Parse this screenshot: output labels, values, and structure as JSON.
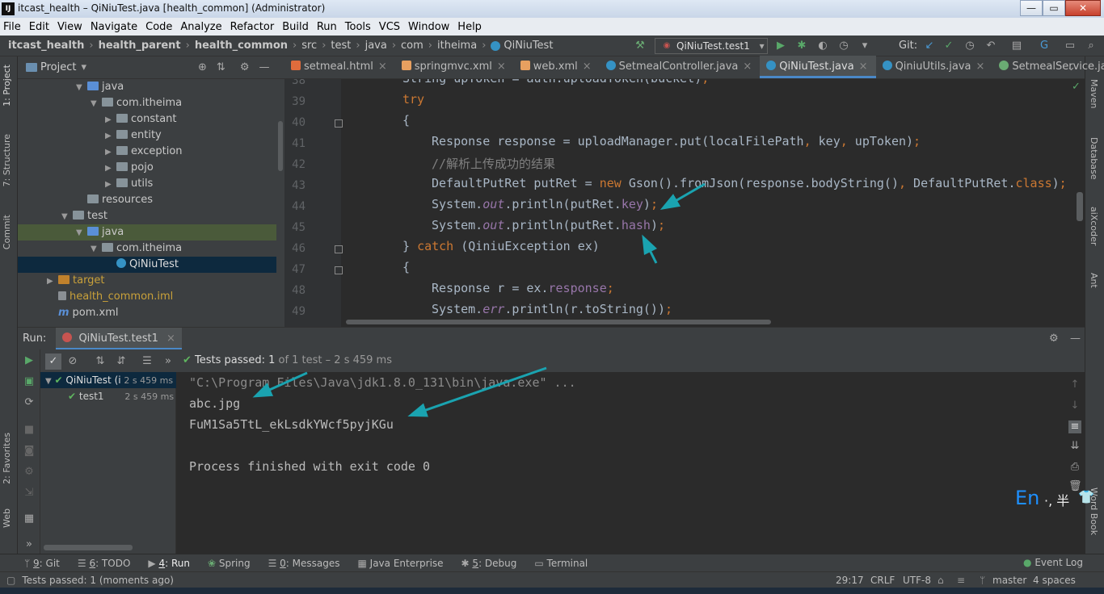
{
  "window": {
    "title": "itcast_health – QiNiuTest.java [health_common] (Administrator)",
    "logo": "IJ",
    "minimize": "—",
    "maximize": "▭",
    "close": "✕"
  },
  "menu": [
    "File",
    "Edit",
    "View",
    "Navigate",
    "Code",
    "Analyze",
    "Refactor",
    "Build",
    "Run",
    "Tools",
    "VCS",
    "Window",
    "Help"
  ],
  "breadcrumb": [
    "itcast_health",
    "health_parent",
    "health_common",
    "src",
    "test",
    "java",
    "com",
    "itheima",
    "QiNiuTest"
  ],
  "toolbar": {
    "run_config": "QiNiuTest.test1",
    "git_label": "Git:"
  },
  "left_strip": [
    "1: Project",
    "7: Structure",
    "Commit",
    "2: Favorites",
    "Web"
  ],
  "right_strip": [
    "Maven",
    "Database",
    "aiXcoder",
    "Ant",
    "Word Book"
  ],
  "project": {
    "header": "Project",
    "tree": [
      {
        "label": "java",
        "indent": 5,
        "arrow": "▼",
        "kind": "src"
      },
      {
        "label": "com.itheima",
        "indent": 6,
        "arrow": "▼",
        "kind": "pkg"
      },
      {
        "label": "constant",
        "indent": 7,
        "arrow": "▶",
        "kind": "pkg"
      },
      {
        "label": "entity",
        "indent": 7,
        "arrow": "▶",
        "kind": "pkg"
      },
      {
        "label": "exception",
        "indent": 7,
        "arrow": "▶",
        "kind": "pkg"
      },
      {
        "label": "pojo",
        "indent": 7,
        "arrow": "▶",
        "kind": "pkg"
      },
      {
        "label": "utils",
        "indent": 7,
        "arrow": "▶",
        "kind": "pkg"
      },
      {
        "label": "resources",
        "indent": 5,
        "arrow": "",
        "kind": "folder"
      },
      {
        "label": "test",
        "indent": 4,
        "arrow": "▼",
        "kind": "folder"
      },
      {
        "label": "java",
        "indent": 5,
        "arrow": "▼",
        "kind": "src"
      },
      {
        "label": "com.itheima",
        "indent": 6,
        "arrow": "▼",
        "kind": "pkg"
      },
      {
        "label": "QiNiuTest",
        "indent": 7,
        "arrow": "",
        "kind": "class"
      },
      {
        "label": "target",
        "indent": 3,
        "arrow": "▶",
        "kind": "target"
      },
      {
        "label": "health_common.iml",
        "indent": 3,
        "arrow": "",
        "kind": "iml"
      },
      {
        "label": "pom.xml",
        "indent": 3,
        "arrow": "",
        "kind": "pom"
      }
    ]
  },
  "tabs": [
    {
      "label": "setmeal.html",
      "icon": "html"
    },
    {
      "label": "springmvc.xml",
      "icon": "xml"
    },
    {
      "label": "web.xml",
      "icon": "xml"
    },
    {
      "label": "SetmealController.java",
      "icon": "class"
    },
    {
      "label": "QiNiuTest.java",
      "icon": "class",
      "active": true
    },
    {
      "label": "QiniuUtils.java",
      "icon": "class"
    },
    {
      "label": "SetmealService.java",
      "icon": "iface"
    }
  ],
  "editor": {
    "line_numbers": [
      "38",
      "39",
      "40",
      "41",
      "42",
      "43",
      "44",
      "45",
      "46",
      "47",
      "48",
      "49"
    ],
    "lines": [
      "String upToken = auth.uploadToken(bucket);",
      "try",
      "{",
      "Response response = uploadManager.put(localFilePath, key, upToken);",
      "//解析上传成功的结果",
      "DefaultPutRet putRet = new Gson().fromJson(response.bodyString(), DefaultPutRet.class);",
      "System.out.println(putRet.key);",
      "System.out.println(putRet.hash);",
      "} catch (QiniuException ex)",
      "{",
      "Response r = ex.response;",
      "System.err.println(r.toString());"
    ]
  },
  "run": {
    "label": "Run:",
    "tab": "QiNiuTest.test1",
    "status_bold": "Tests passed: 1",
    "status_rest": " of 1 test – 2 s 459 ms",
    "tree": [
      {
        "label": "QiNiuTest (i",
        "time": "2 s 459 ms"
      },
      {
        "label": "test1",
        "time": "2 s 459 ms"
      }
    ],
    "console": [
      "\"C:\\Program Files\\Java\\jdk1.8.0_131\\bin\\java.exe\" ...",
      "abc.jpg",
      "FuM1Sa5TtL_ekLsdkYWcf5pyjKGu",
      "",
      "Process finished with exit code 0"
    ]
  },
  "bottom_tabs": [
    {
      "num": "9",
      "label": ": Git"
    },
    {
      "num": "6",
      "label": ": TODO"
    },
    {
      "num": "4",
      "label": ": Run"
    },
    {
      "num": "",
      "label": "Spring"
    },
    {
      "num": "0",
      "label": ": Messages"
    },
    {
      "num": "",
      "label": "Java Enterprise"
    },
    {
      "num": "5",
      "label": ": Debug"
    },
    {
      "num": "",
      "label": "Terminal"
    }
  ],
  "event_log": "Event Log",
  "status": {
    "message": "Tests passed: 1 (moments ago)",
    "position": "29:17",
    "line_sep": "CRLF",
    "encoding": "UTF-8",
    "branch": "master",
    "indent": "4 spaces"
  },
  "ime": {
    "lang": "En",
    "extra": "·, 半"
  },
  "colors": {
    "accent": "#4a88c7",
    "pass": "#5fb55f",
    "arrow": "#1aa3b0"
  }
}
